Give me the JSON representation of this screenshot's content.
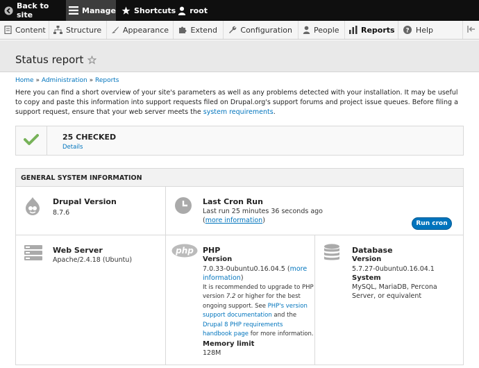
{
  "toolbar": {
    "back": "Back to site",
    "manage": "Manage",
    "shortcuts": "Shortcuts",
    "user": "root"
  },
  "tray": {
    "items": [
      "Content",
      "Structure",
      "Appearance",
      "Extend",
      "Configuration",
      "People",
      "Reports",
      "Help"
    ]
  },
  "page": {
    "title": "Status report",
    "breadcrumb": [
      "Home",
      "Administration",
      "Reports"
    ],
    "breadcrumb_sep": "»",
    "intro_text": "Here you can find a short overview of your site's parameters as well as any problems detected with your installation. It may be useful to copy and paste this information into support requests filed on Drupal.org's support forums and project issue queues. Before filing a support request, ensure that your web server meets the ",
    "intro_link": "system requirements",
    "intro_end": "."
  },
  "checked": {
    "count": "25 CHECKED",
    "details": "Details"
  },
  "system_info": {
    "heading": "GENERAL SYSTEM INFORMATION",
    "drupal": {
      "title": "Drupal Version",
      "value": "8.7.6"
    },
    "cron": {
      "title": "Last Cron Run",
      "value": "Last run 25 minutes 36 seconds ago",
      "more_open": "(",
      "more_link": "more information",
      "more_close": ")",
      "button": "Run cron"
    },
    "webserver": {
      "title": "Web Server",
      "value": "Apache/2.4.18 (Ubuntu)"
    },
    "php": {
      "title": "PHP",
      "version_label": "Version",
      "version_value": "7.0.33-0ubuntu0.16.04.5 (",
      "more_link": "more information",
      "more_close": ")",
      "note_1": "It is recommended to upgrade to PHP version ",
      "note_version": "7.2",
      "note_2": " or higher for the best ongoing support. See ",
      "note_link_1": "PHP's version support documentation",
      "note_3": " and the ",
      "note_link_2": "Drupal 8 PHP requirements handbook page",
      "note_4": " for more information.",
      "memory_label": "Memory limit",
      "memory_value": "128M"
    },
    "database": {
      "title": "Database",
      "version_label": "Version",
      "version_value": "5.7.27-0ubuntu0.16.04.1",
      "system_label": "System",
      "system_value": "MySQL, MariaDB, Percona Server, or equivalent"
    }
  },
  "colors": {
    "accent": "#0074bd",
    "check": "#77b259",
    "toolbar": "#0f0f0f"
  }
}
